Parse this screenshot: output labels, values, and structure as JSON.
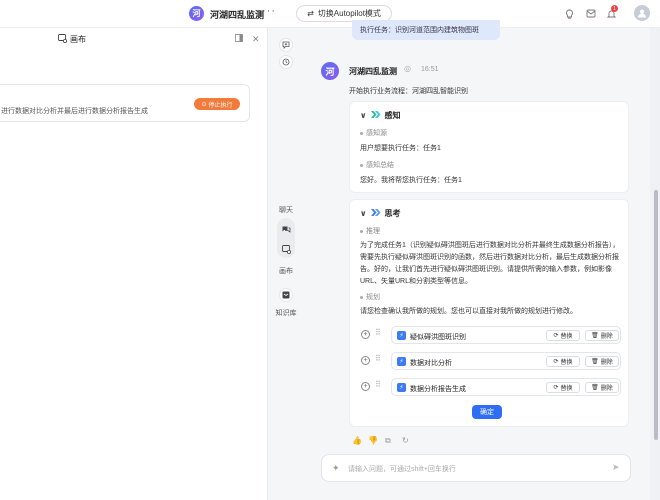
{
  "header": {
    "app_logo": "河",
    "app_title": "河湖四乱监测",
    "more": "···",
    "switch_label": "切换Autopilot模式",
    "badge": "1",
    "avatar": "👤"
  },
  "canvas": {
    "title": "画布",
    "task_text": "进行数据对比分析并最后进行数据分析报告生成",
    "stop_label": "停止执行"
  },
  "rail": {
    "chat_label": "聊天",
    "canvas_label": "画布",
    "kb_label": "知识库"
  },
  "chat": {
    "prev_message": "执行任务：识别河道范围内建筑物图斑",
    "bot_avatar": "河",
    "bot_name": "河湖四乱监测",
    "time": "16:51",
    "flow_start": "开始执行业务流程：河湖四乱智能识别",
    "perception": {
      "title": "感知",
      "source_label": "感知源",
      "source_text": "用户想要执行任务：任务1",
      "summary_label": "感知总结",
      "summary_text": "您好。我将帮您执行任务：任务1"
    },
    "thinking": {
      "title": "思考",
      "reasoning_label": "推理",
      "reasoning_text": "为了完成任务1（识别疑似碍洪图斑后进行数据对比分析并最终生成数据分析报告），需要先执行疑似碍洪图斑识别的函数，然后进行数据对比分析，最后生成数据分析报告。好的，让我们首先进行疑似碍洪图斑识别。请提供所需的输入参数，例如影像URL、矢量URL和分割类型等信息。",
      "plan_label": "规划",
      "plan_text": "请您检查确认我所做的规划。您也可以直接对我所做的规划进行修改。",
      "plan_items": [
        {
          "name": "疑似碍洪图斑识别",
          "replace": "替换",
          "delete": "删除"
        },
        {
          "name": "数据对比分析",
          "replace": "替换",
          "delete": "删除"
        },
        {
          "name": "数据分析报告生成",
          "replace": "替换",
          "delete": "删除"
        }
      ],
      "confirm_label": "确定"
    },
    "input_placeholder": "请输入问题，可通过shift+回车换行"
  }
}
